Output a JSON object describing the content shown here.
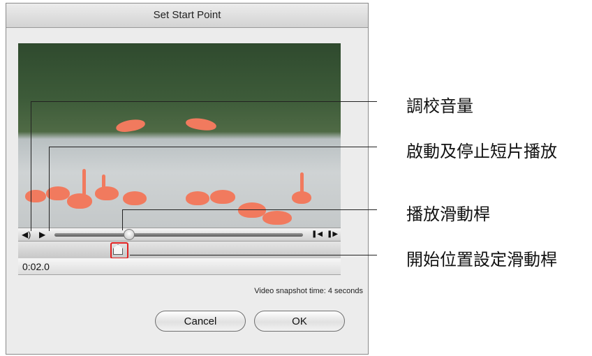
{
  "dialog": {
    "title": "Set Start Point"
  },
  "player": {
    "volume_icon": "speaker-icon",
    "play_icon": "play-icon",
    "step_back_icon": "step-back-icon",
    "step_forward_icon": "step-forward-icon",
    "playback_position": 0.3
  },
  "start_point": {
    "time": "0:02.0"
  },
  "snapshot_text": "Video snapshot time: 4 seconds",
  "buttons": {
    "cancel": "Cancel",
    "ok": "OK"
  },
  "callouts": {
    "volume": "調校音量",
    "play_stop": "啟動及停止短片播放",
    "playback_slider": "播放滑動桿",
    "start_slider": "開始位置設定滑動桿"
  },
  "colors": {
    "highlight": "#e02020",
    "flamingo": "#f17a5e"
  }
}
